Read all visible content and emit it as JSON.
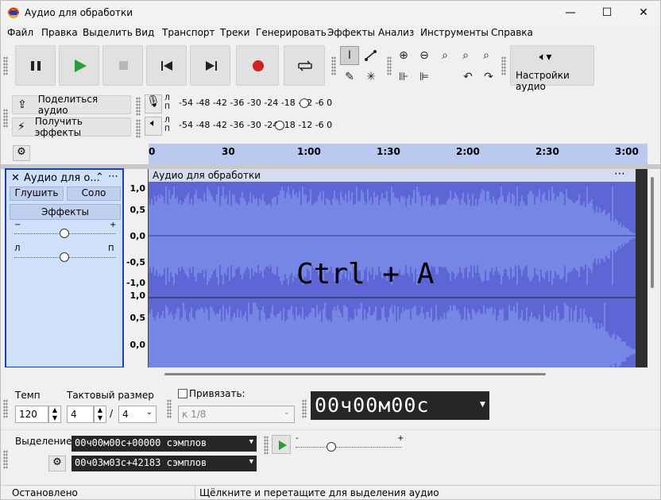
{
  "window": {
    "title": "Аудио для обработки",
    "controls": [
      "—",
      "☐",
      "✕"
    ]
  },
  "menu": [
    "Файл",
    "Правка",
    "Выделить",
    "Вид",
    "Транспорт",
    "Треки",
    "Генерировать",
    "Эффекты",
    "Анализ",
    "Инструменты",
    "Справка"
  ],
  "toolbar": {
    "share_label": "Поделиться аудио",
    "effects_label": "Получить эффекты",
    "audio_settings_label": "Настройки аудио"
  },
  "meters": {
    "record": {
      "l": "Л",
      "r": "П",
      "scale": "-54 -48 -42 -36 -30 -24 -18 -12  -6   0"
    },
    "play": {
      "l": "Л",
      "r": "П",
      "scale": "-54 -48 -42 -36 -30 -24 -18 -12  -6   0"
    }
  },
  "ruler": {
    "ticks": [
      "0",
      "30",
      "1:00",
      "1:30",
      "2:00",
      "2:30",
      "3:00"
    ]
  },
  "track": {
    "name": "Аудио для о...",
    "clip_title": "Аудио для обработки",
    "mute": "Глушить",
    "solo": "Соло",
    "effects": "Эффекты",
    "gain_minus": "−",
    "gain_plus": "+",
    "pan_left": "Л",
    "pan_right": "П",
    "scale_labels": [
      "1,0",
      "0,5",
      "0,0",
      "-0,5",
      "-1,0",
      "1,0",
      "0,5",
      "0,0"
    ]
  },
  "overlay_text": "Ctrl + A",
  "bottom": {
    "tempo_label": "Темп",
    "tempo_value": "120",
    "meter_label": "Тактовый размер",
    "meter_num": "4",
    "meter_sep": "/",
    "meter_den": "4",
    "snap_label": "Привязать:",
    "snap_value": "к 1/8",
    "time_display": "00ч00м00с",
    "selection_label": "Выделение",
    "sel_start": "00ч00м00с+00000 сэмплов",
    "sel_end": "00ч03м03с+42183 сэмплов",
    "play_minus": "-",
    "play_plus": "+"
  },
  "status": {
    "left": "Остановлено",
    "right": "Щёлкните и перетащите для выделения аудио"
  },
  "colors": {
    "wave_bg": "#5e66d6",
    "wave_fg": "#8fa6f2",
    "track_border": "#1b3fb2",
    "record": "#d02020",
    "play": "#2a9a3a"
  }
}
